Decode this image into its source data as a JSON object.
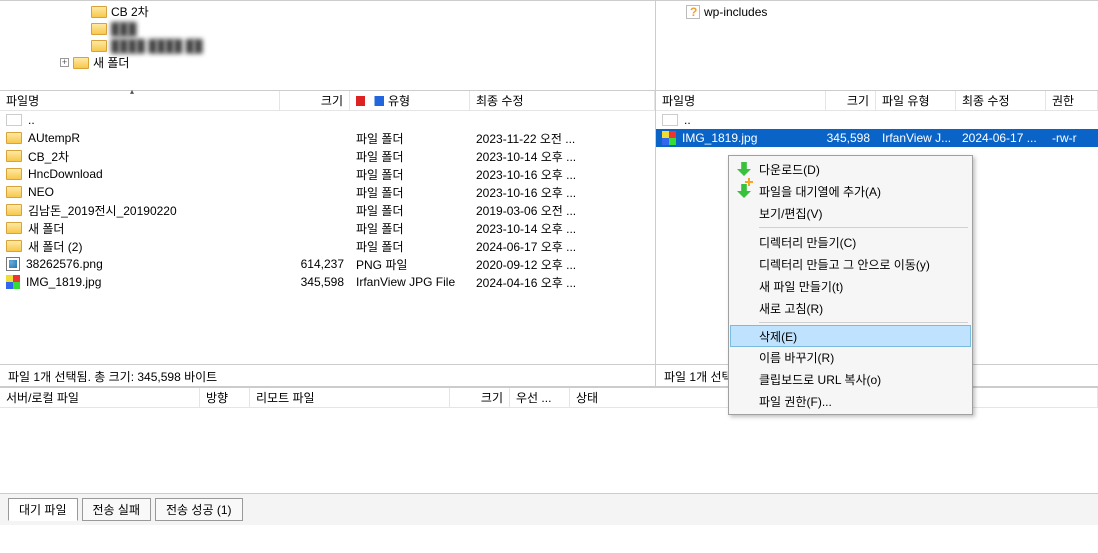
{
  "treeLeft": [
    {
      "indent": 0,
      "type": "folder",
      "name": "CB 2차",
      "exp": ""
    },
    {
      "indent": 0,
      "type": "folder",
      "name": "███",
      "blur": true,
      "exp": ""
    },
    {
      "indent": 0,
      "type": "folder",
      "name": "████ ████ ██",
      "blur": true,
      "exp": ""
    },
    {
      "indent": -1,
      "type": "folder",
      "name": "새 폴더",
      "exp": "+"
    }
  ],
  "treeRight": [
    {
      "type": "q",
      "name": "wp-includes"
    }
  ],
  "headers": {
    "name": "파일명",
    "size": "크기",
    "type": "유형",
    "mod": "최종 수정",
    "perm": "권한"
  },
  "filetype": "파일 유형",
  "localRows": [
    {
      "icon": "up",
      "name": ".."
    },
    {
      "icon": "folder",
      "name": "AUtempR",
      "type": "파일 폴더",
      "mod": "2023-11-22 오전 ..."
    },
    {
      "icon": "folder",
      "name": "CB_2차",
      "type": "파일 폴더",
      "mod": "2023-10-14 오후 ..."
    },
    {
      "icon": "folder",
      "name": "HncDownload",
      "type": "파일 폴더",
      "mod": "2023-10-16 오후 ..."
    },
    {
      "icon": "folder",
      "name": "NEO",
      "type": "파일 폴더",
      "mod": "2023-10-16 오후 ..."
    },
    {
      "icon": "folder",
      "name": "김남돈_2019전시_20190220",
      "type": "파일 폴더",
      "mod": "2019-03-06 오전 ..."
    },
    {
      "icon": "folder",
      "name": "새 폴더",
      "type": "파일 폴더",
      "mod": "2023-10-14 오후 ..."
    },
    {
      "icon": "folder",
      "name": "새 폴더 (2)",
      "type": "파일 폴더",
      "mod": "2024-06-17 오후 ..."
    },
    {
      "icon": "png",
      "name": "38262576.png",
      "size": "614,237",
      "type": "PNG 파일",
      "mod": "2020-09-12 오후 ..."
    },
    {
      "icon": "jpg",
      "name": "IMG_1819.jpg",
      "size": "345,598",
      "type": "IrfanView JPG File",
      "mod": "2024-04-16 오후 ..."
    }
  ],
  "remoteRows": [
    {
      "icon": "up",
      "name": ".."
    },
    {
      "icon": "jpg",
      "name": "IMG_1819.jpg",
      "size": "345,598",
      "type": "IrfanView J...",
      "mod": "2024-06-17 ...",
      "perm": "-rw-r",
      "sel": true
    }
  ],
  "localStatus": "파일 1개 선택됨. 총 크기: 345,598 바이트",
  "remoteStatus": "파일 1개 선택",
  "transferHdr": {
    "server": "서버/로컬 파일",
    "dir": "방향",
    "remote": "리모트 파일",
    "size": "크기",
    "prio": "우선 ...",
    "state": "상태"
  },
  "tabs": {
    "queue": "대기 파일",
    "fail": "전송 실패",
    "ok": "전송 성공 (1)"
  },
  "ctx": {
    "download": "다운로드(D)",
    "add": "파일을 대기열에 추가(A)",
    "view": "보기/편집(V)",
    "mkdir": "디렉터리 만들기(C)",
    "mkdircd": "디렉터리 만들고 그 안으로 이동(y)",
    "mkfile": "새 파일 만들기(t)",
    "refresh": "새로 고침(R)",
    "delete": "삭제(E)",
    "rename": "이름 바꾸기(R)",
    "copyurl": "클립보드로 URL 복사(o)",
    "perm": "파일 권한(F)..."
  }
}
